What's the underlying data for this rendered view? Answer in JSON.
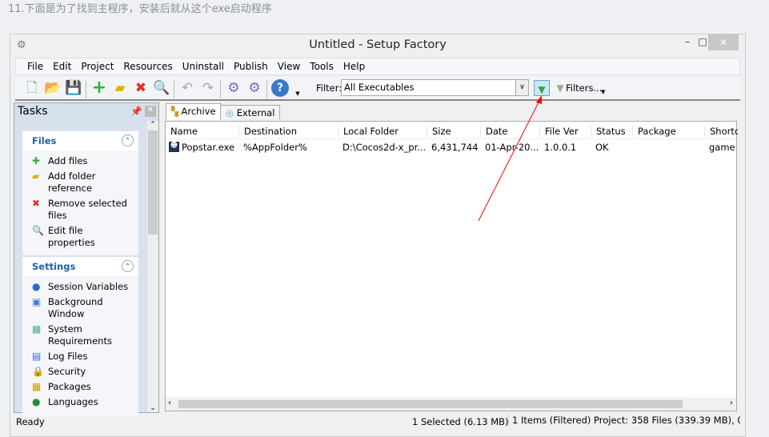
{
  "caption": "11.下面是为了找到主程序，安装后就从这个exe启动程序",
  "window": {
    "title": "Untitled - Setup Factory",
    "minimize": "–",
    "maximize": "□",
    "close": "✕"
  },
  "menu": [
    "File",
    "Edit",
    "Project",
    "Resources",
    "Uninstall",
    "Publish",
    "View",
    "Tools",
    "Help"
  ],
  "toolbar": {
    "filter_label": "Filter:",
    "filter_value": "All Executables",
    "filters_button": "Filters..."
  },
  "tasks": {
    "title": "Tasks",
    "files": {
      "title": "Files",
      "items": [
        "Add files",
        "Add folder reference",
        "Remove selected files",
        "Edit file properties"
      ]
    },
    "settings": {
      "title": "Settings",
      "items": [
        "Session Variables",
        "Background Window",
        "System Requirements",
        "Log Files",
        "Security",
        "Packages",
        "Languages"
      ]
    }
  },
  "tabs": [
    "Archive",
    "External"
  ],
  "columns": [
    "Name",
    "Destination",
    "Local Folder",
    "Size",
    "Date",
    "File Ver",
    "Status",
    "Package",
    "Shortc"
  ],
  "rows": [
    {
      "name": "Popstar.exe",
      "destination": "%AppFolder%",
      "local_folder": "D:\\Cocos2d-x_pr...",
      "size": "6,431,744",
      "date": "01-Apr-20...",
      "file_ver": "1.0.0.1",
      "status": "OK",
      "package": "",
      "shortcut": "game"
    }
  ],
  "statusbar": {
    "ready": "Ready",
    "selected": "1 Selected (6.13 MB)",
    "items": "1 Items (Filtered) Project: 358 Files (339.39 MB), 0 F"
  },
  "annotation_color": "#ff0000"
}
